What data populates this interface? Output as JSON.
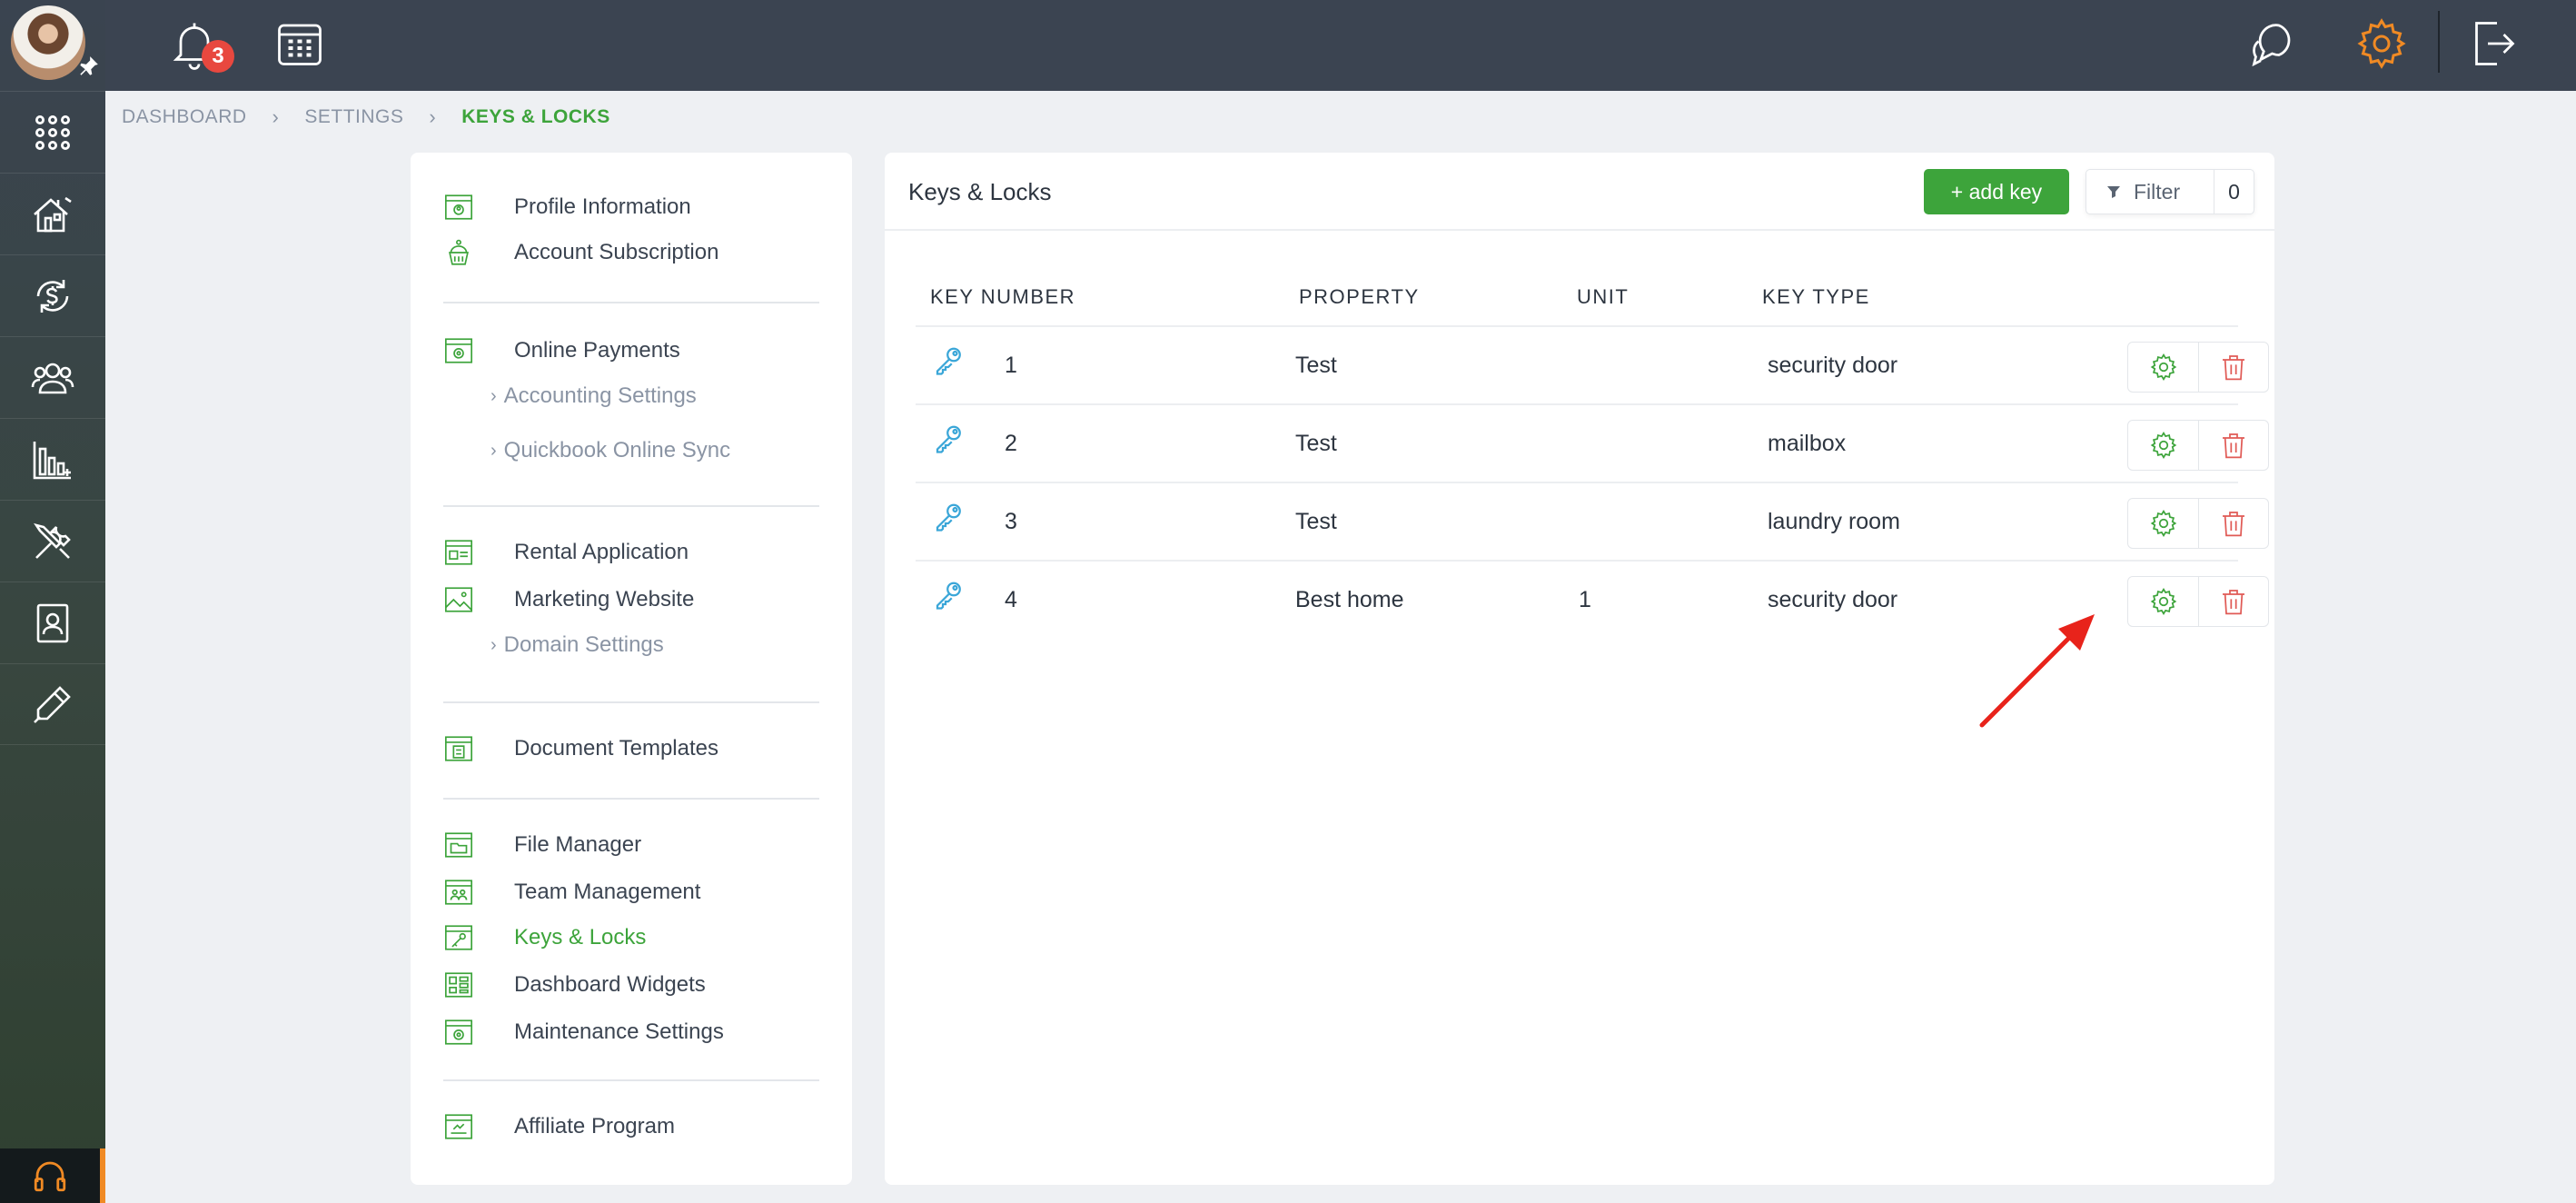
{
  "topbar": {
    "notification_count": "3",
    "icons": [
      "bell-icon",
      "calendar-icon",
      "chat-icon",
      "gear-icon",
      "logout-icon"
    ],
    "colors": {
      "accent": "#f08a24",
      "bar": "#3b4451"
    }
  },
  "rail": {
    "icons": [
      "apps-grid-icon",
      "building-icon",
      "money-cycle-icon",
      "people-icon",
      "chart-icon",
      "tools-icon",
      "contact-card-icon",
      "pen-icon",
      "headset-icon"
    ]
  },
  "breadcrumb": {
    "items": [
      "DASHBOARD",
      "SETTINGS",
      "KEYS & LOCKS"
    ]
  },
  "menu": {
    "profile_information": "Profile Information",
    "account_subscription": "Account Subscription",
    "online_payments": "Online Payments",
    "accounting_settings": "Accounting Settings",
    "quickbook_sync": "Quickbook Online Sync",
    "rental_application": "Rental Application",
    "marketing_website": "Marketing Website",
    "domain_settings": "Domain Settings",
    "document_templates": "Document Templates",
    "file_manager": "File Manager",
    "team_management": "Team Management",
    "keys_locks": "Keys & Locks",
    "dashboard_widgets": "Dashboard Widgets",
    "maintenance_settings": "Maintenance Settings",
    "affiliate_program": "Affiliate Program"
  },
  "panel": {
    "title": "Keys & Locks",
    "add_label": "+ add key",
    "filter_label": "Filter",
    "filter_count": "0"
  },
  "table": {
    "headers": [
      "KEY NUMBER",
      "PROPERTY",
      "UNIT",
      "KEY TYPE"
    ],
    "rows": [
      {
        "number": "1",
        "property": "Test",
        "unit": "",
        "type": "security door"
      },
      {
        "number": "2",
        "property": "Test",
        "unit": "",
        "type": "mailbox"
      },
      {
        "number": "3",
        "property": "Test",
        "unit": "",
        "type": "laundry room"
      },
      {
        "number": "4",
        "property": "Best home",
        "unit": "1",
        "type": "security door"
      }
    ]
  }
}
